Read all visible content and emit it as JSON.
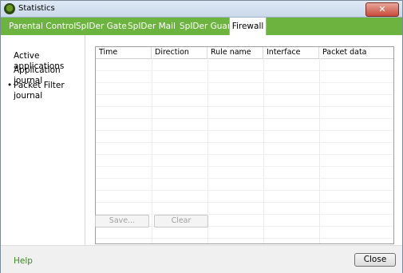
{
  "window": {
    "title": "Statistics"
  },
  "tabs": [
    {
      "label": "Parental Control",
      "active": false
    },
    {
      "label": "SpIDer Gate",
      "active": false
    },
    {
      "label": "SpIDer Mail",
      "active": false
    },
    {
      "label": "SpIDer Guard",
      "active": false
    },
    {
      "label": "Firewall",
      "active": true
    }
  ],
  "sidebar": {
    "items": [
      {
        "label": "Active applications",
        "selected": false
      },
      {
        "label": "Application journal",
        "selected": false
      },
      {
        "label": "Packet Filter journal",
        "selected": true
      }
    ]
  },
  "table": {
    "columns": [
      "Time",
      "Direction",
      "Rule name",
      "Interface",
      "Packet data"
    ],
    "rows": []
  },
  "actions": {
    "save_label": "Save...",
    "clear_label": "Clear"
  },
  "footer": {
    "help_label": "Help",
    "close_label": "Close"
  },
  "colors": {
    "accent": "#6db33f",
    "help_link": "#3a8a1f"
  }
}
